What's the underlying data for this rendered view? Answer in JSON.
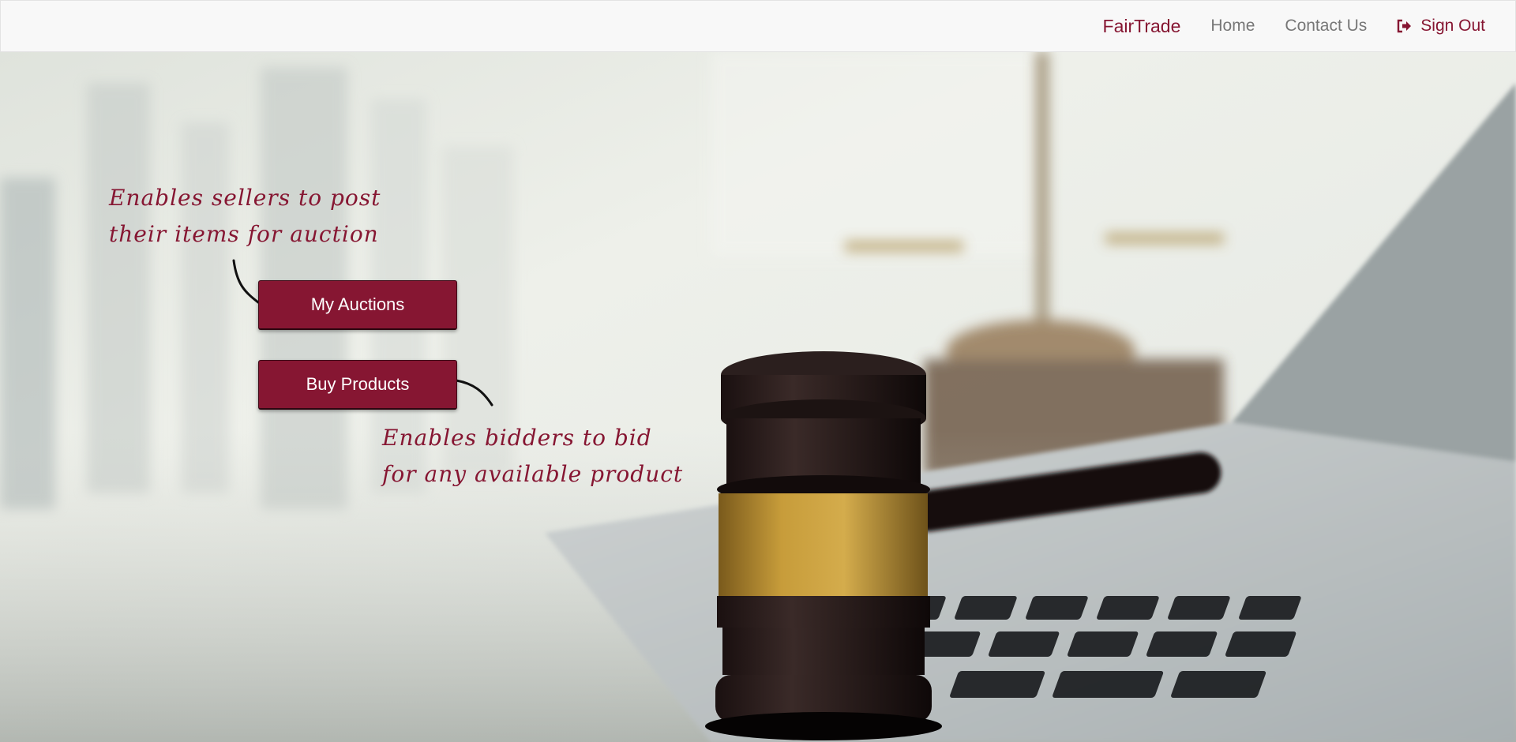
{
  "navbar": {
    "brand": "FairTrade",
    "home": "Home",
    "contact": "Contact Us",
    "signout": "Sign Out"
  },
  "annotations": {
    "sellers_line1": "Enables sellers to post",
    "sellers_line2": "their items for auction",
    "bidders_line1": "Enables bidders to bid",
    "bidders_line2": "for any available product"
  },
  "buttons": {
    "my_auctions": "My Auctions",
    "buy_products": "Buy Products"
  },
  "icons": {
    "signout": "sign-out-icon"
  },
  "colors": {
    "accent": "#861632",
    "navbar_bg": "#f8f8f8",
    "nav_link": "#777777"
  }
}
